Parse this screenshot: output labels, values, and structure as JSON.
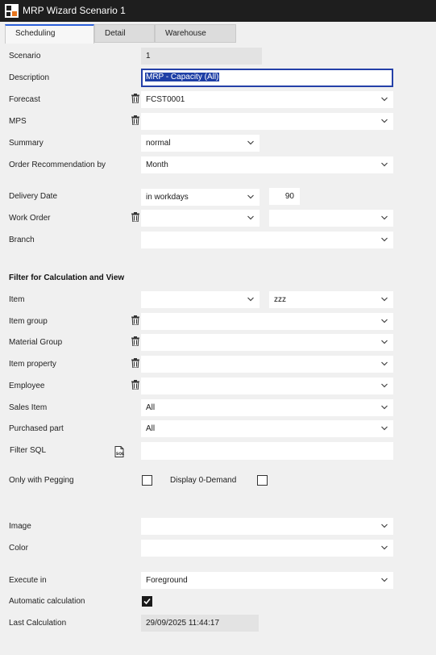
{
  "window": {
    "title": "MRP Wizard Scenario 1"
  },
  "tabs": [
    "Scheduling",
    "Detail",
    "Warehouse"
  ],
  "form": {
    "scenario": {
      "label": "Scenario",
      "value": "1"
    },
    "description": {
      "label": "Description",
      "value": "MRP - Capacity (All)"
    },
    "forecast": {
      "label": "Forecast",
      "value": "FCST0001"
    },
    "mps": {
      "label": "MPS",
      "value": ""
    },
    "summary": {
      "label": "Summary",
      "value": "normal"
    },
    "order_recommendation": {
      "label": "Order Recommendation by",
      "value": "Month"
    },
    "delivery_date": {
      "label": "Delivery Date",
      "unit": "in workdays",
      "value": "90"
    },
    "work_order": {
      "label": "Work Order",
      "value1": "",
      "value2": ""
    },
    "branch": {
      "label": "Branch",
      "value": ""
    }
  },
  "filter": {
    "heading": "Filter for Calculation and View",
    "item": {
      "label": "Item",
      "from": "",
      "to": "zzz"
    },
    "item_group": {
      "label": "Item group",
      "value": ""
    },
    "material_group": {
      "label": "Material Group",
      "value": ""
    },
    "item_property": {
      "label": "Item property",
      "value": ""
    },
    "employee": {
      "label": "Employee",
      "value": ""
    },
    "sales_item": {
      "label": "Sales Item",
      "value": "All"
    },
    "purchased_part": {
      "label": "Purchased part",
      "value": "All"
    },
    "filter_sql": {
      "label": "Filter SQL",
      "value": ""
    },
    "only_with_pegging": {
      "label": "Only with Pegging",
      "checked": false
    },
    "display_zero_demand": {
      "label": "Display 0-Demand",
      "checked": false
    }
  },
  "appearance": {
    "image": {
      "label": "Image",
      "value": ""
    },
    "color": {
      "label": "Color",
      "value": ""
    }
  },
  "execution": {
    "execute_in": {
      "label": "Execute in",
      "value": "Foreground"
    },
    "automatic_calculation": {
      "label": "Automatic calculation",
      "checked": true
    },
    "last_calculation": {
      "label": "Last Calculation",
      "value": "29/09/2025 11:44:17"
    }
  },
  "colors": {
    "titlebar": "#1e1e1e",
    "accent": "#2b5fd9",
    "focus": "#2440a8",
    "background": "#f0f0f0"
  },
  "icons": [
    "app-logo-icon",
    "trash-icon",
    "chevron-down-icon",
    "sql-file-icon",
    "check-icon"
  ]
}
